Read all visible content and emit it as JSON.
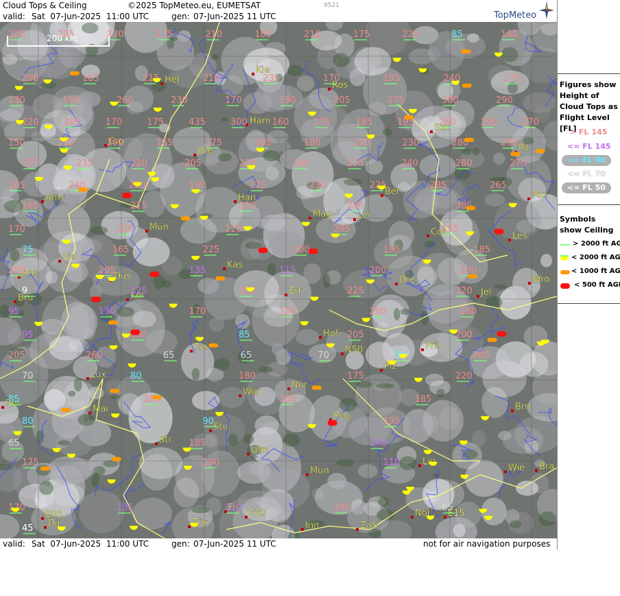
{
  "header": {
    "title": "Cloud Tops & Ceiling",
    "copyright": "©2025 TopMeteo.eu, EUMETSAT",
    "code": "9521",
    "valid_label": "valid:",
    "valid_value": "Sat  07-Jun-2025  11:00 UTC",
    "gen_label": "gen:",
    "gen_value": "07-Jun-2025 11 UTC",
    "brand": "TopMeteo",
    "disclaimer": "not for air navigation purposes"
  },
  "scale_bar": "200 km",
  "colors": {
    "pink": "#f08a8a",
    "violet": "#c070f0",
    "cyan": "#60e8ff",
    "light_grey": "#d8d8d8",
    "green_line": "#7dff7d",
    "yellow": "#ffff00",
    "orange": "#ff9900",
    "red": "#ff1010",
    "border": "#ffff80",
    "river": "#3a4cff",
    "place_text": "#ffff60"
  },
  "legend": {
    "title": "Figures show Height of Cloud Tops as Flight Level  [FL]",
    "items": [
      {
        "label": "> FL 145",
        "color": "#f08a8a"
      },
      {
        "label": "<= FL 145",
        "color": "#c070f0"
      },
      {
        "label": "<= FL 90",
        "color": "#60e8ff"
      },
      {
        "label": "<= FL 70",
        "color": "#e0e0e0"
      },
      {
        "label": "<= FL 50",
        "color": "#ffffff"
      }
    ],
    "symbols_title": "Symbols show Ceiling",
    "symbols": [
      {
        "label": "> 2000 ft AGL",
        "kind": "line"
      },
      {
        "label": "< 2000 ft AGL",
        "kind": "yellow-semi"
      },
      {
        "label": "< 1000 ft AGL",
        "kind": "orange-bar"
      },
      {
        "label": "< 500 ft AGL",
        "kind": "red-bar"
      }
    ]
  },
  "places": [
    "Kie",
    "Hel",
    "Ros",
    "Ham",
    "Szc",
    "Gro",
    "Bre",
    "Pil",
    "Ber",
    "Ams",
    "Han",
    "Mag",
    "Lei",
    "Poz",
    "Mün",
    "Cot",
    "Les",
    "Ein",
    "Kas",
    "Dre",
    "Wro",
    "Ant",
    "Düs",
    "Bru",
    "Köl",
    "Erf",
    "Jel",
    "Hof",
    "Fra",
    "N50",
    "Prä",
    "Lux",
    "Wür",
    "Plz",
    "Nür",
    "Mai",
    "Rei",
    "Brn",
    "Reg",
    "Stu",
    "Str",
    "Ulm",
    "Lin",
    "Mün",
    "Wie",
    "Bra",
    "Fri",
    "E10",
    "Nöl",
    "E15",
    "Dij",
    "E05",
    "Zür",
    "Inn",
    "ZaS"
  ],
  "cloud_levels": [
    {
      "row": 1,
      "values": [
        "220",
        "225",
        "230",
        "175",
        "210",
        "180",
        "210",
        "175",
        "225",
        "85",
        "160"
      ]
    },
    {
      "row": 2,
      "values": [
        "200",
        "165",
        "215",
        "210",
        "235",
        "170",
        "195",
        "240",
        "275"
      ]
    },
    {
      "row": 3,
      "values": [
        "230",
        "190",
        "260",
        "230",
        "170",
        "190",
        "205",
        "275",
        "300",
        "290"
      ]
    },
    {
      "row": 4,
      "values": [
        "220",
        "205",
        "170",
        "175",
        "435",
        "300",
        "160",
        "175",
        "185",
        "195",
        "260",
        "290",
        "270"
      ]
    },
    {
      "row": 5,
      "values": [
        "150",
        "235",
        "290",
        "165",
        "175",
        "165",
        "180",
        "190",
        "230",
        "280",
        "290"
      ]
    },
    {
      "row": 6,
      "values": [
        "175",
        "235",
        "220",
        "205",
        "220",
        "180",
        "225",
        "240",
        "280",
        "270"
      ]
    },
    {
      "row": 7,
      "values": [
        "165",
        "240",
        "220",
        "190",
        "175",
        "230",
        "225",
        "285",
        "265"
      ]
    },
    {
      "row": 8,
      "values": [
        "190",
        "215",
        "230",
        "280",
        "305"
      ]
    },
    {
      "row": 9,
      "values": [
        "170",
        "220",
        "220",
        "295",
        "155"
      ]
    },
    {
      "row": 10,
      "values": [
        "75",
        "165",
        "225",
        "200",
        "195",
        "185"
      ]
    },
    {
      "row": 11,
      "values": [
        "200",
        "205",
        "135",
        "115",
        "200",
        "200"
      ]
    },
    {
      "row": 12,
      "values": [
        "9",
        "125",
        "190",
        "225",
        "320"
      ]
    },
    {
      "row": 13,
      "values": [
        "95",
        "130",
        "170",
        "150",
        "200",
        "180"
      ]
    },
    {
      "row": 14,
      "values": [
        "95",
        "190",
        "85",
        "205",
        "200"
      ]
    },
    {
      "row": 15,
      "values": [
        "205",
        "260",
        "65",
        "65",
        "70",
        "80",
        "205"
      ]
    },
    {
      "row": 16,
      "values": [
        "70",
        "80",
        "180",
        "175",
        "220"
      ]
    },
    {
      "row": 17,
      "values": [
        "85",
        "285",
        "200",
        "185"
      ]
    },
    {
      "row": 18,
      "values": [
        "80",
        "90",
        "195"
      ]
    },
    {
      "row": 19,
      "values": [
        "65",
        "185",
        "140"
      ]
    },
    {
      "row": 20,
      "values": [
        "175",
        "190",
        "110"
      ]
    },
    {
      "row": 21,
      "values": [
        "170",
        "135",
        "110",
        "185",
        "65"
      ]
    },
    {
      "row": 22,
      "values": [
        "45"
      ]
    }
  ]
}
